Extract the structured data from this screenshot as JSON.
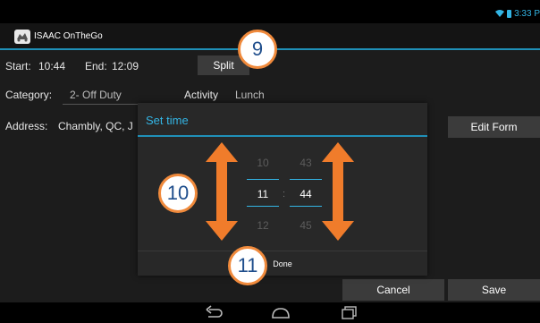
{
  "status": {
    "time": "3:33 P"
  },
  "app": {
    "title": "ISAAC OnTheGo"
  },
  "form": {
    "start_label": "Start:",
    "start_value": "10:44",
    "end_label": "End:",
    "end_value": "12:09",
    "split_label": "Split",
    "category_label": "Category:",
    "category_value": "2- Off Duty",
    "activity_label": "Activity",
    "activity_value": "Lunch",
    "address_label": "Address:",
    "address_value": "Chambly, QC, J",
    "edit_form_label": "Edit Form",
    "cancel_label": "Cancel",
    "save_label": "Save"
  },
  "dialog": {
    "title": "Set time",
    "hours": {
      "prev": "10",
      "current": "11",
      "next": "12"
    },
    "separator": ":",
    "minutes": {
      "prev": "43",
      "current": "44",
      "next": "45"
    },
    "done_label": "Done"
  },
  "callouts": [
    "9",
    "10",
    "11"
  ],
  "colors": {
    "accent": "#33b5e5",
    "callout_border": "#f08a3c",
    "arrow": "#f07c2b",
    "callout_text": "#1f4e8c"
  }
}
